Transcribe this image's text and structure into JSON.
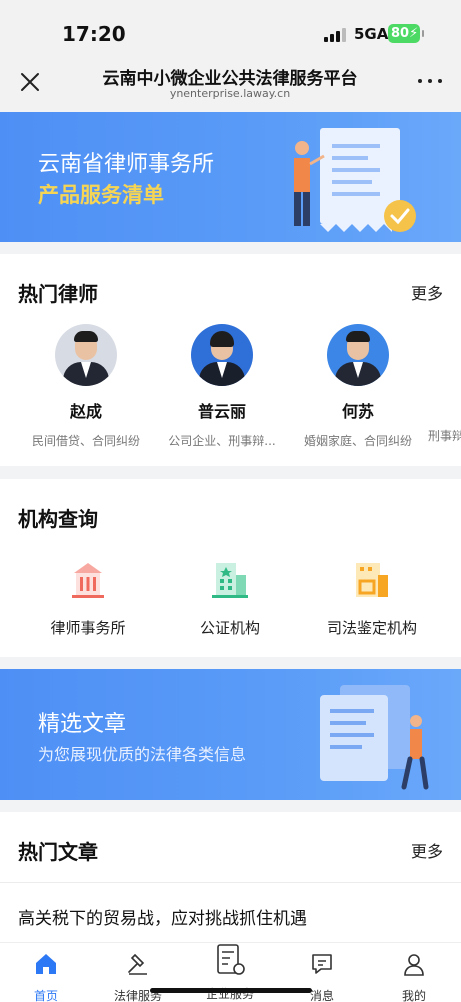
{
  "status_bar": {
    "time": "17:20",
    "network": "5GA",
    "battery": "80"
  },
  "nav": {
    "title": "云南中小微企业公共法律服务平台",
    "url": "ynenterprise.laway.cn"
  },
  "banner1": {
    "title": "云南省律师事务所",
    "subtitle": "产品服务清单"
  },
  "lawyers": {
    "title": "热门律师",
    "more": "更多",
    "items": [
      {
        "name": "赵成",
        "tags": "民间借贷、合同纠纷"
      },
      {
        "name": "普云丽",
        "tags": "公司企业、刑事辩..."
      },
      {
        "name": "何苏",
        "tags": "婚姻家庭、合同纠纷"
      },
      {
        "name": "",
        "tags": "刑事辩"
      }
    ]
  },
  "orgs": {
    "title": "机构查询",
    "items": [
      {
        "label": "律师事务所",
        "icon": "law-firm-icon"
      },
      {
        "label": "公证机构",
        "icon": "notary-icon"
      },
      {
        "label": "司法鉴定机构",
        "icon": "forensic-icon"
      }
    ]
  },
  "banner2": {
    "title": "精选文章",
    "subtitle": "为您展现优质的法律各类信息"
  },
  "articles": {
    "title": "热门文章",
    "more": "更多",
    "items": [
      {
        "title": "高关税下的贸易战，应对挑战抓住机遇"
      }
    ]
  },
  "tabs": [
    {
      "label": "首页",
      "icon": "home-icon",
      "active": true
    },
    {
      "label": "法律服务",
      "icon": "gavel-icon",
      "active": false
    },
    {
      "label": "企业服务",
      "icon": "document-icon",
      "active": false
    },
    {
      "label": "消息",
      "icon": "message-icon",
      "active": false
    },
    {
      "label": "我的",
      "icon": "user-icon",
      "active": false
    }
  ],
  "colors": {
    "accent": "#2d78f4",
    "banner": "#5a9cf7",
    "highlight": "#f7d554"
  }
}
